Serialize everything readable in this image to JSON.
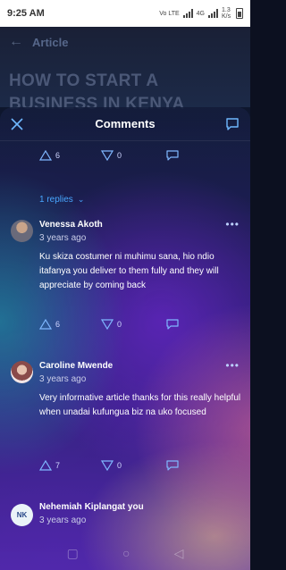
{
  "status_bar": {
    "time": "9:25 AM",
    "network_labels": "Vo LTE",
    "network_type": "4G",
    "speed": "1.3 K/s"
  },
  "article": {
    "header_label": "Article",
    "title": "HOW TO START A BUSINESS IN KENYA"
  },
  "comments_sheet": {
    "title": "Comments",
    "top_actions": {
      "likes": "6",
      "dislikes": "0"
    },
    "replies_label": "1 replies",
    "comments": [
      {
        "author": "Venessa Akoth",
        "time": "3 years ago",
        "text": "Ku skiza costumer ni muhimu sana, hio ndio itafanya you deliver to them fully and they will appreciate by coming back",
        "likes": "6",
        "dislikes": "0"
      },
      {
        "author": "Caroline Mwende",
        "time": "3 years ago",
        "text": "Very informative article thanks for this really helpful when unadai kufungua biz na uko focused",
        "likes": "7",
        "dislikes": "0"
      },
      {
        "author": "Nehemiah Kiplangat you",
        "time": "3 years ago",
        "initials": "NK"
      }
    ]
  },
  "colors": {
    "accent_link": "#48a6ff",
    "text_primary": "#ffffff",
    "text_secondary": "#c9cde8"
  }
}
